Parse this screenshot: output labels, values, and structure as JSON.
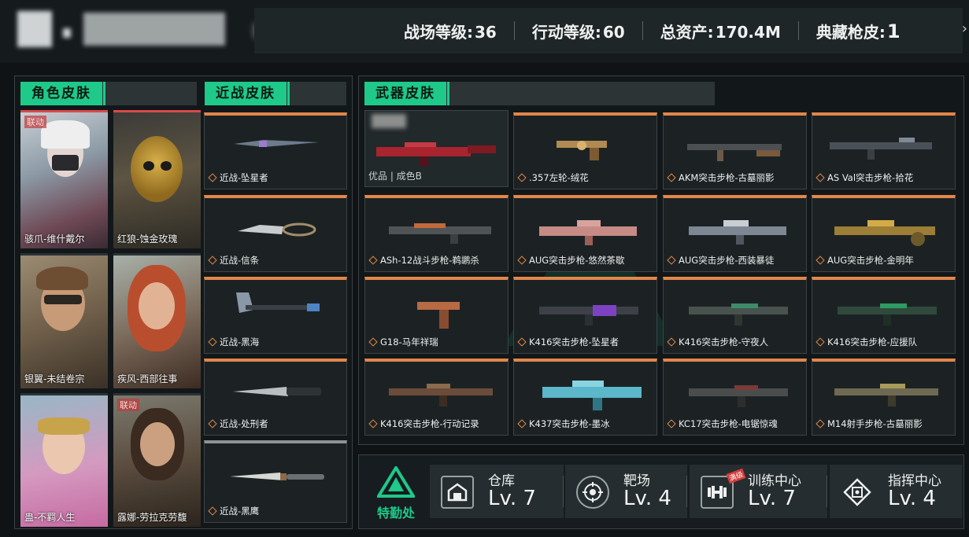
{
  "header": {
    "stats": [
      {
        "label": "战场等级:",
        "value": "36"
      },
      {
        "label": "行动等级: ",
        "value": "60"
      },
      {
        "label": "总资产:",
        "value": "170.4M"
      },
      {
        "label": "典藏枪皮:",
        "value": "1"
      }
    ],
    "arrow": "›"
  },
  "character_section": {
    "title": "角色皮肤",
    "cards": [
      {
        "label": "骇爪-维什戴尔",
        "collab": "联动"
      },
      {
        "label": "红狼-蚀金玫瑰",
        "collab": ""
      },
      {
        "label": "银翼-未结卷宗",
        "collab": ""
      },
      {
        "label": "疾风-西部往事",
        "collab": ""
      },
      {
        "label": "蛊-不羁人生",
        "collab": ""
      },
      {
        "label": "露娜-劳拉克劳馥",
        "collab": "联动"
      }
    ]
  },
  "melee_section": {
    "title": "近战皮肤",
    "items": [
      {
        "label": "近战-坠星者"
      },
      {
        "label": "近战-信条"
      },
      {
        "label": "近战-黑海"
      },
      {
        "label": "近战-处刑者"
      },
      {
        "label": "近战-黑鹰"
      }
    ]
  },
  "weapon_section": {
    "title": "武器皮肤",
    "featured": {
      "quality": "优品 | 成色B"
    },
    "items": [
      {
        "label": ".357左轮-绒花"
      },
      {
        "label": "AKM突击步枪-古墓丽影"
      },
      {
        "label": "AS Val突击步枪-拾花"
      },
      {
        "label": "ASh-12战斗步枪-鹈鹕杀"
      },
      {
        "label": "AUG突击步枪-悠然茶歇"
      },
      {
        "label": "AUG突击步枪-西装暴徒"
      },
      {
        "label": "AUG突击步枪-金明年"
      },
      {
        "label": "G18-马年祥瑞"
      },
      {
        "label": "K416突击步枪-坠星者"
      },
      {
        "label": "K416突击步枪-守夜人"
      },
      {
        "label": "K416突击步枪-应援队"
      },
      {
        "label": "K416突击步枪-行动记录"
      },
      {
        "label": "K437突击步枪-墨冰"
      },
      {
        "label": "KC17突击步枪-电锯惊魂"
      },
      {
        "label": "M14射手步枪-古墓丽影"
      }
    ]
  },
  "bottom": {
    "dept_label": "特勤处",
    "facilities": [
      {
        "name": "仓库",
        "level": "Lv. 7",
        "icon": "warehouse-icon"
      },
      {
        "name": "靶场",
        "level": "Lv. 4",
        "icon": "target-icon"
      },
      {
        "name": "训练中心",
        "level": "Lv. 7",
        "icon": "dumbbell-icon",
        "badge": "满级"
      },
      {
        "name": "指挥中心",
        "level": "Lv. 4",
        "icon": "command-icon"
      }
    ]
  },
  "colors": {
    "accent_green": "#1ec98a",
    "accent_orange": "#e2874a",
    "collab_red": "#d94a4a"
  }
}
